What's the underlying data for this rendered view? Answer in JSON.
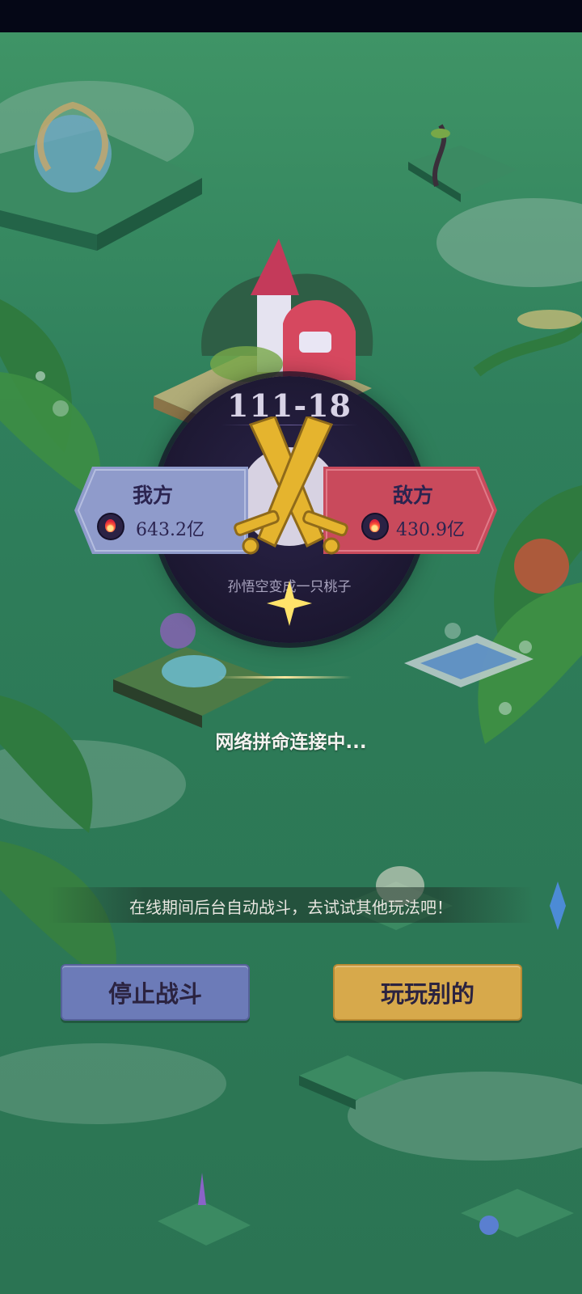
{
  "battle": {
    "stage": "111-18",
    "our_side": {
      "label": "我方",
      "power": "643.2亿"
    },
    "enemy_side": {
      "label": "敌方",
      "power": "430.9亿"
    },
    "subtitle": "孙悟空变成一只桃子"
  },
  "status": {
    "connecting": "网络拼命连接中..."
  },
  "tip": "在线期间后台自动战斗，去试试其他玩法吧！",
  "buttons": {
    "stop": "停止战斗",
    "play_other": "玩玩别的"
  },
  "colors": {
    "our_side": "#8f9bcb",
    "enemy_side": "#c94a5c",
    "stop_button": "#6c7bb8",
    "play_button": "#d7a94b",
    "badge": "#1d1832"
  }
}
